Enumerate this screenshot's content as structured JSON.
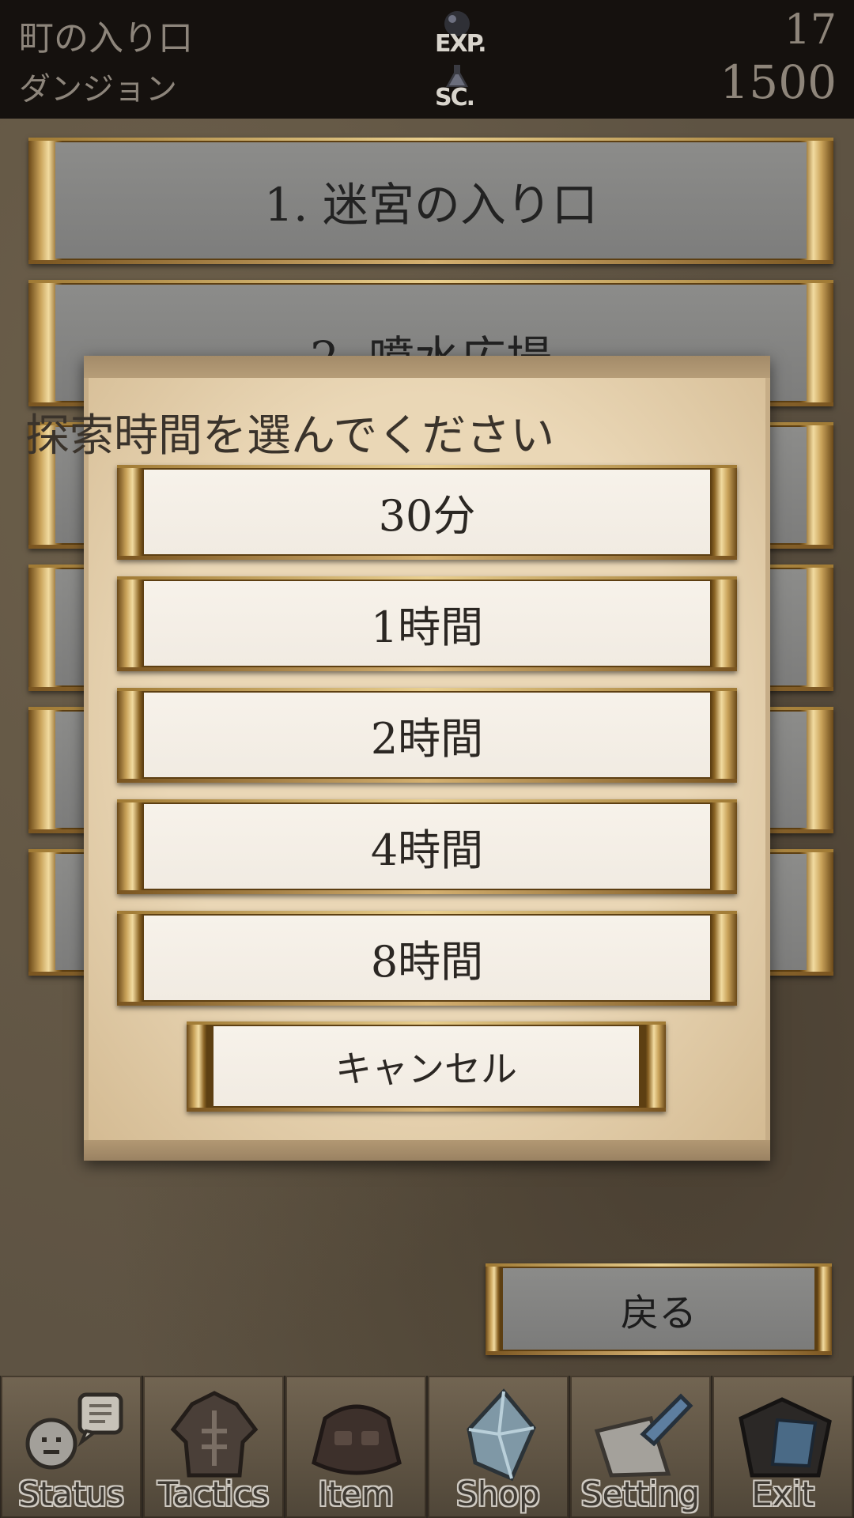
{
  "header": {
    "location": "町の入り口",
    "sublocation": "ダンジョン",
    "exp_label": "EXP.",
    "exp_value": "17",
    "score_label": "SC.",
    "score_value": "1500",
    "exp_icon": "orb-icon",
    "score_icon": "flask-icon"
  },
  "dungeon_list": [
    {
      "label": "1. 迷宮の入り口"
    },
    {
      "label": "2. 噴水広場"
    },
    {
      "label": ""
    },
    {
      "label": ""
    },
    {
      "label": ""
    },
    {
      "label": ""
    }
  ],
  "modal": {
    "title": "探索時間を選んでください",
    "options": [
      {
        "label": "30分"
      },
      {
        "label": "1時間"
      },
      {
        "label": "2時間"
      },
      {
        "label": "4時間"
      },
      {
        "label": "8時間"
      }
    ],
    "cancel_label": "キャンセル"
  },
  "back_button": {
    "label": "戻る"
  },
  "nav": [
    {
      "label": "Status",
      "icon": "speech-face-icon"
    },
    {
      "label": "Tactics",
      "icon": "armor-icon"
    },
    {
      "label": "Item",
      "icon": "bag-icon"
    },
    {
      "label": "Shop",
      "icon": "crystal-icon"
    },
    {
      "label": "Setting",
      "icon": "hammer-icon"
    },
    {
      "label": "Exit",
      "icon": "exit-door-icon"
    }
  ],
  "colors": {
    "gold_frame": "#c9a35a",
    "header_bg": "#15110e",
    "modal_bg": "#ead7b6"
  }
}
